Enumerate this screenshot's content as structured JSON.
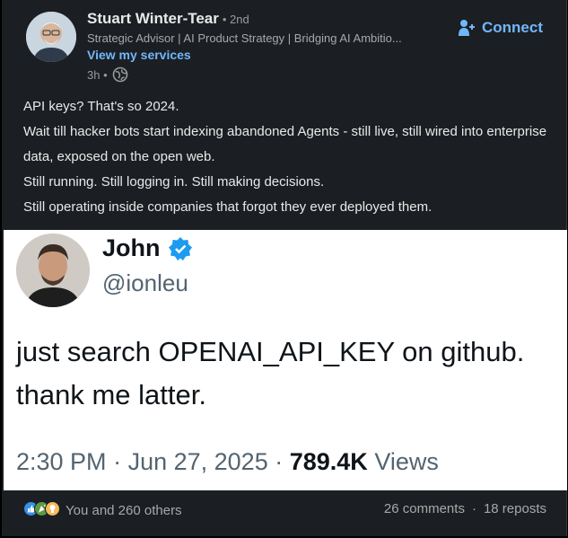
{
  "author": {
    "name": "Stuart Winter-Tear",
    "degree": "• 2nd",
    "headline": "Strategic Advisor | AI Product Strategy | Bridging AI Ambitio...",
    "services_link": "View my services",
    "time": "3h •",
    "connect_label": "Connect",
    "visibility_icon": "globe-icon"
  },
  "post": {
    "lines": [
      "API keys? That's so 2024.",
      "Wait till hacker bots start indexing abandoned Agents - still live, still wired into enterprise data, exposed on the open web.",
      "Still running. Still logging in. Still making decisions.",
      "Still operating inside companies that forgot they ever deployed them."
    ]
  },
  "tweet": {
    "name": "John",
    "handle": "@ionleu",
    "text_line1": "just search OPENAI_API_KEY on github.",
    "text_line2": "thank me latter.",
    "time": "2:30 PM",
    "date": "Jun 27, 2025",
    "views_count": "789.4K",
    "views_label": "Views",
    "verified_color": "#1d9bf0"
  },
  "social": {
    "reactions_text": "You and 260 others",
    "comments": "26 comments",
    "reposts": "18 reposts",
    "reaction_icons": [
      "like-icon",
      "celebrate-icon",
      "insightful-icon"
    ]
  },
  "colors": {
    "link": "#71b7fb",
    "card_bg": "#1b1f23"
  }
}
